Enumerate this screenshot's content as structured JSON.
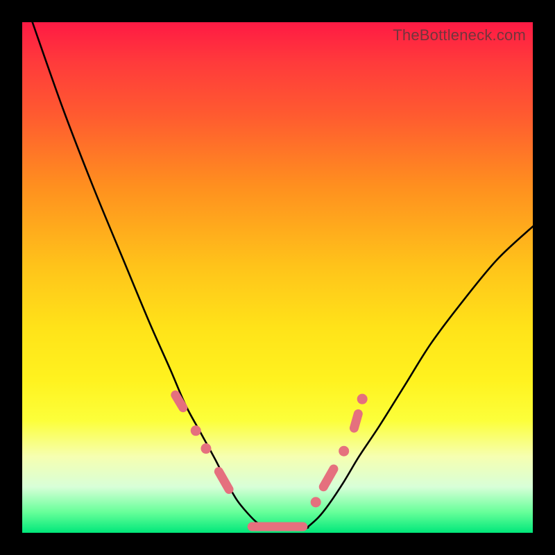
{
  "source_watermark": "TheBottleneck.com",
  "chart_data": {
    "type": "line",
    "title": "",
    "xlabel": "",
    "ylabel": "",
    "xlim": [
      0,
      100
    ],
    "ylim": [
      0,
      100
    ],
    "background_gradient": {
      "top_color": "#ff1a44",
      "middle_color": "#ffe319",
      "bottom_color": "#00e77a",
      "meaning": "red=high bottleneck, green=no bottleneck"
    },
    "series": [
      {
        "name": "left-curve",
        "description": "steep descending curve from upper-left to valley floor",
        "x": [
          2,
          8,
          14,
          20,
          25,
          29,
          32,
          35,
          38,
          40,
          42,
          44,
          46,
          48
        ],
        "values": [
          100,
          83,
          67.5,
          53,
          41,
          32,
          25,
          19.5,
          14,
          10,
          6.5,
          4,
          2,
          1
        ]
      },
      {
        "name": "right-curve",
        "description": "ascending curve from valley floor toward upper-right",
        "x": [
          56,
          58,
          60,
          63,
          66,
          70,
          75,
          80,
          86,
          93,
          100
        ],
        "values": [
          1.2,
          3,
          5.5,
          10,
          15,
          21,
          29,
          37,
          45,
          53.5,
          60
        ]
      },
      {
        "name": "valley-floor",
        "description": "flat optimal region at bottom",
        "x": [
          46,
          50,
          54,
          56
        ],
        "values": [
          1,
          0.6,
          0.6,
          1
        ]
      }
    ],
    "highlighted_segments": {
      "description": "salmon-pink marker capsules along the curve near the valley",
      "left_side_points": [
        [
          30,
          27
        ],
        [
          31.5,
          24.5
        ],
        [
          34,
          20
        ],
        [
          36,
          16.5
        ],
        [
          38.5,
          12
        ],
        [
          40.5,
          8.5
        ]
      ],
      "floor_segment": {
        "x_start": 45,
        "x_end": 55,
        "y": 1.2
      },
      "right_side_points": [
        [
          57.5,
          6
        ],
        [
          59,
          9
        ],
        [
          61,
          12.5
        ],
        [
          63,
          16
        ],
        [
          65,
          20.5
        ],
        [
          65.8,
          23.3
        ],
        [
          66.6,
          26.2
        ]
      ]
    }
  }
}
